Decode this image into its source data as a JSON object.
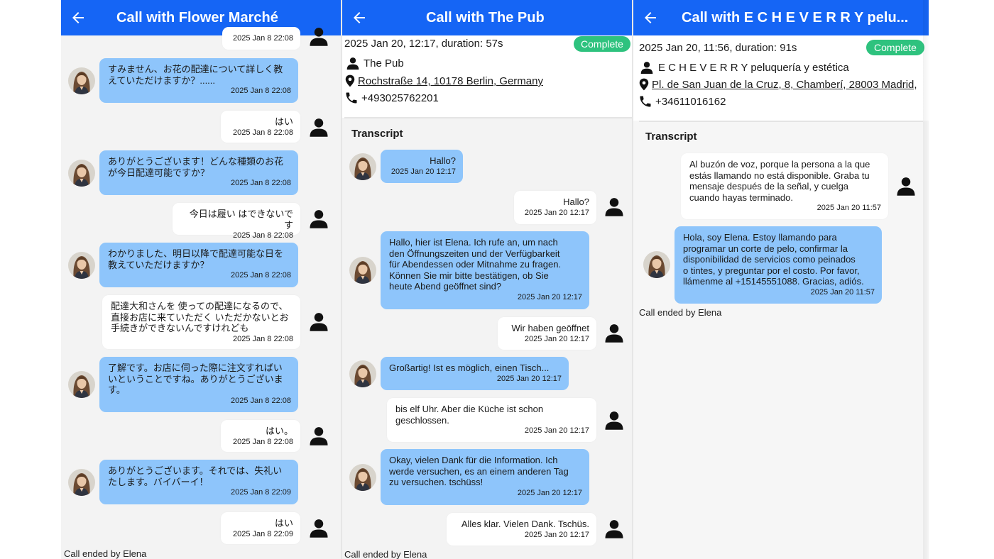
{
  "panel1": {
    "title": "Call with Flower Marché",
    "top_time": "2025 Jan 8 22:08",
    "messages": [
      {
        "text": "すみません、お花の配達について詳しく教\nえていただけますか？......",
        "time": "2025 Jan 8 22:08"
      },
      {
        "text": "はい",
        "time": "2025 Jan 8 22:08"
      },
      {
        "text": "ありがとうございます！どんな種類のお花\nが今日配達可能ですか？",
        "time": "2025 Jan 8 22:08"
      },
      {
        "text": "今日は履い はできないです",
        "time": "2025 Jan 8 22:08"
      },
      {
        "text": "わかりました、明日以降で配達可能な日を\n教えていただけますか？",
        "time": "2025 Jan 8 22:08"
      },
      {
        "text": "配達大和さんを 使っての配達になるので、\n直接お店に来ていただく いただかないとお\n手続きができないんですけれども",
        "time": "2025 Jan 8 22:08"
      },
      {
        "text": "了解です。お店に伺った際に注文すればい\nいということですね。ありがとうございま\nす。",
        "time": "2025 Jan 8 22:08"
      },
      {
        "text": "はい。",
        "time": "2025 Jan 8 22:08"
      },
      {
        "text": "ありがとうございます。それでは、失礼い\nたします。バイバーイ！",
        "time": "2025 Jan 8 22:09"
      },
      {
        "text": "はい",
        "time": "2025 Jan 8 22:09"
      }
    ],
    "footer": "Call ended by Elena"
  },
  "panel2": {
    "title": "Call with The Pub",
    "summary": "2025 Jan 20, 12:17, duration: 57s",
    "status": "Complete",
    "name": "The Pub",
    "address": "Rochstraße 14, 10178 Berlin, Germany",
    "phone": "+493025762201",
    "transcript_label": "Transcript",
    "messages": [
      {
        "text": "Hallo?",
        "time": "2025 Jan 20 12:17"
      },
      {
        "text": "Hallo?",
        "time": "2025 Jan 20 12:17"
      },
      {
        "text": "Hallo, hier ist Elena. Ich rufe an, um nach\nden Öffnungszeiten und der Verfügbarkeit\nfür Abendessen oder Mitnahme zu fragen.\nKönnen Sie mir bitte bestätigen, ob Sie\nheute Abend geöffnet sind?",
        "time": "2025 Jan 20 12:17"
      },
      {
        "text": "Wir haben geöffnet",
        "time": "2025 Jan 20 12:17"
      },
      {
        "text": "Großartig! Ist es möglich, einen Tisch...",
        "time": "2025 Jan 20 12:17"
      },
      {
        "text": "bis elf Uhr. Aber die Küche ist schon\ngeschlossen.",
        "time": "2025 Jan 20 12:17"
      },
      {
        "text": "Okay, vielen Dank für die Information. Ich\nwerde versuchen, es an einem anderen Tag\nzu versuchen. tschüss!",
        "time": "2025 Jan 20 12:17"
      },
      {
        "text": "Alles klar. Vielen Dank. Tschüs.",
        "time": "2025 Jan 20 12:17"
      }
    ],
    "footer": "Call ended by Elena"
  },
  "panel3": {
    "title": "Call with E C H E V E R R Y pelu...",
    "summary": "2025 Jan 20, 11:56, duration: 91s",
    "status": "Complete",
    "name": "E C H E V E R R Y peluquería y estética",
    "address": "Pl. de San Juan de la Cruz, 8, Chamberí, 28003 Madrid,",
    "phone": "+34611016162",
    "transcript_label": "Transcript",
    "messages": [
      {
        "text": "Al buzón de voz, porque la persona a la que\nestás llamando no está disponible. Graba tu\nmensaje después de la señal, y cuelga\ncuando hayas terminado.",
        "time": "2025 Jan 20 11:57"
      },
      {
        "text": "Hola, soy Elena. Estoy llamando para\nprogramar un corte de pelo, confirmar la\ndisponibilidad de servicios como peinados\no tintes, y preguntar por el costo. Por favor,\nllámenme al +15145551088. Gracias, adiós.",
        "time": "2025 Jan 20 11:57"
      }
    ],
    "footer": "Call ended by Elena"
  },
  "icons": {
    "back": "arrow-left-icon",
    "person": "person-icon",
    "pin": "location-pin-icon",
    "phone": "phone-icon",
    "avatar": "avatar-photo"
  },
  "colors": {
    "appbar": "#1565f5",
    "agent_bubble": "#8ec5fb",
    "other_bubble": "#ffffff",
    "chat_bg": "#f3f3f3",
    "status_complete": "#2ec27e"
  }
}
